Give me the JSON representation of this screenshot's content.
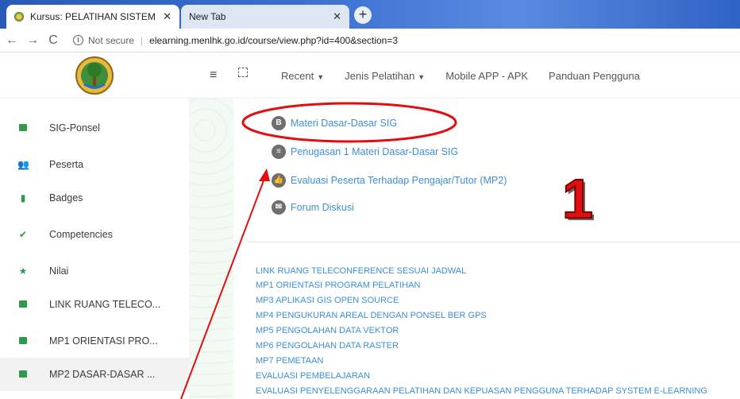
{
  "browser": {
    "active_tab": "Kursus: PELATIHAN SISTEM INFO",
    "inactive_tab": "New Tab",
    "security": "Not secure",
    "url": "elearning.menlhk.go.id/course/view.php?id=400&section=3"
  },
  "navbar": {
    "items": [
      "Recent",
      "Jenis Pelatihan",
      "Mobile APP - APK",
      "Panduan Pengguna"
    ]
  },
  "sidebar": {
    "items": [
      {
        "label": "SIG-Ponsel",
        "icon": "dashboard-icon"
      },
      {
        "label": "Peserta",
        "icon": "users-icon"
      },
      {
        "label": "Badges",
        "icon": "bookmark-icon"
      },
      {
        "label": "Competencies",
        "icon": "check-circle-icon"
      },
      {
        "label": "Nilai",
        "icon": "star-icon"
      },
      {
        "label": "LINK RUANG TELECO...",
        "icon": "folder-icon"
      },
      {
        "label": "MP1 ORIENTASI PRO...",
        "icon": "folder-icon"
      },
      {
        "label": "MP2 DASAR-DASAR ...",
        "icon": "folder-icon"
      }
    ]
  },
  "main": {
    "activities": [
      {
        "label": "Materi Dasar-Dasar SIG",
        "icon": "book-icon"
      },
      {
        "label": "Penugasan 1 Materi Dasar-Dasar SIG",
        "icon": "assignment-icon"
      },
      {
        "label": "Evaluasi Peserta Terhadap Pengajar/Tutor (MP2)",
        "icon": "thumbs-up-icon"
      },
      {
        "label": "Forum Diskusi",
        "icon": "forum-icon"
      }
    ],
    "sections": [
      "LINK RUANG TELECONFERENCE SESUAI JADWAL",
      "MP1 ORIENTASI PROGRAM PELATIHAN",
      "MP3 APLIKASI GIS OPEN SOURCE",
      "MP4 PENGUKURAN AREAL DENGAN PONSEL BER GPS",
      "MP5 PENGOLAHAN DATA VEKTOR",
      "MP6 PENGOLAHAN DATA RASTER",
      "MP7 PEMETAAN",
      "EVALUASI PEMBELAJARAN",
      "EVALUASI PENYELENGGARAAN PELATIHAN DAN KEPUASAN PENGGUNA TERHADAP SYSTEM E-LEARNING"
    ]
  },
  "annotation": {
    "number": "1",
    "color": "#e10f0f"
  }
}
